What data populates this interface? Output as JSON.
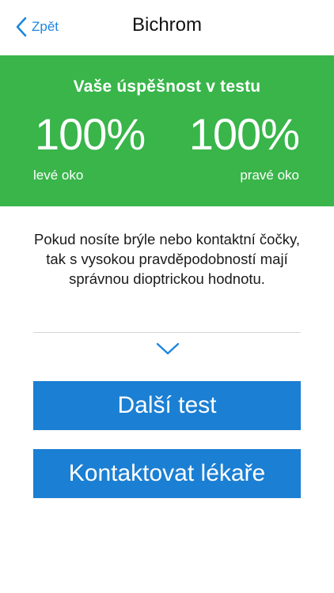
{
  "navbar": {
    "back_label": "Zpět",
    "back_icon": "chevron-left-icon",
    "title": "Bichrom"
  },
  "result": {
    "heading": "Vaše úspěšnost v testu",
    "left_score": "100%",
    "right_score": "100%",
    "left_label": "levé oko",
    "right_label": "pravé oko"
  },
  "message": "Pokud nosíte brýle nebo kontaktní čočky, tak s vysokou pravděpodobností mají správnou dioptrickou hodnotu.",
  "expand_icon": "chevron-down-icon",
  "buttons": {
    "next_test": "Další test",
    "contact_doctor": "Kontaktovat lékaře"
  },
  "colors": {
    "accent": "#1e86e0",
    "result_bg": "#39b54a",
    "button_bg": "#1b7fd3"
  }
}
